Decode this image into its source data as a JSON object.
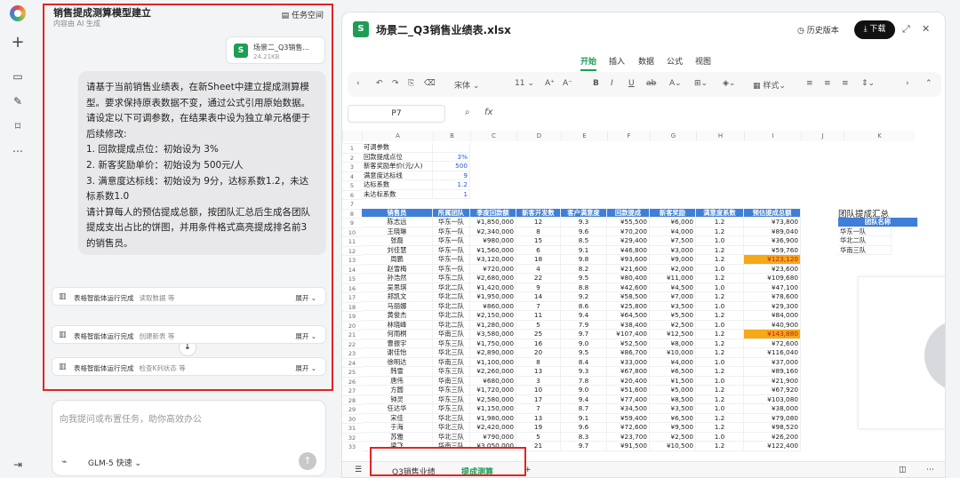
{
  "chat": {
    "title": "销售提成测算模型建立",
    "subtitle": "内容由 AI 生成",
    "task_space": "任务空间",
    "file": {
      "name": "场景二_Q3销售...",
      "size": "24.21KB"
    },
    "prompt_lines": [
      "请基于当前销售业绩表，在新Sheet中建立提成测算模",
      "型。要求保持原表数据不变，通过公式引用原始数据。",
      "请设定以下可调参数，在结果表中设为独立单元格便于",
      "后续修改:",
      "1. 回款提成点位：初始设为 3%",
      "2. 新客奖励单价：初始设为 500元/人",
      "3. 满意度达标线：初始设为 9分，达标系数1.2，未达",
      "标系数1.0",
      "请计算每人的预估提成总额，按团队汇总后生成各团队",
      "提成支出占比的饼图，并用条件格式高亮提成排名前3",
      "的销售员。"
    ],
    "tools": [
      {
        "title": "表格智能体运行完成",
        "detail": "读取数据 等",
        "expand": "展开"
      },
      {
        "title": "表格智能体运行完成",
        "detail": "创建新表 等",
        "expand": "展开"
      },
      {
        "title": "表格智能体运行完成",
        "detail": "检查K列状态 等",
        "expand": "展开"
      }
    ],
    "input_placeholder": "向我提问或布置任务，助你高效办公",
    "model": "GLM-5 快速"
  },
  "sheet": {
    "title": "场景二_Q3销售业绩表.xlsx",
    "history": "历史版本",
    "download": "下载",
    "menus": [
      "开始",
      "插入",
      "数据",
      "公式",
      "视图"
    ],
    "font": "宋体",
    "font_size": "11",
    "style_label": "样式",
    "cell_ref": "P7",
    "columns": [
      "A",
      "B",
      "C",
      "D",
      "E",
      "F",
      "G",
      "H",
      "I",
      "J",
      "K"
    ],
    "params": [
      [
        "可调参数",
        ""
      ],
      [
        "回款提成点位",
        "3%"
      ],
      [
        "新客奖励单价(元/人)",
        "500"
      ],
      [
        "满意度达标线",
        "9"
      ],
      [
        "达标系数",
        "1.2"
      ],
      [
        "未达标系数",
        "1"
      ]
    ],
    "headers": [
      "销售员",
      "所属团队",
      "季度回款额",
      "新客开发数",
      "客户满意度",
      "回款提成",
      "新客奖励",
      "满意度系数",
      "预估提成总额"
    ],
    "rows": [
      [
        "陈志远",
        "华东一队",
        "¥1,850,000",
        "12",
        "9.3",
        "¥55,500",
        "¥6,000",
        "1.2",
        "¥73,800"
      ],
      [
        "王晓琳",
        "华东一队",
        "¥2,340,000",
        "8",
        "9.6",
        "¥70,200",
        "¥4,000",
        "1.2",
        "¥89,040"
      ],
      [
        "张磊",
        "华东一队",
        "¥980,000",
        "15",
        "8.5",
        "¥29,400",
        "¥7,500",
        "1.0",
        "¥36,900"
      ],
      [
        "刘佳慧",
        "华东一队",
        "¥1,560,000",
        "6",
        "9.1",
        "¥46,800",
        "¥3,000",
        "1.2",
        "¥59,760"
      ],
      [
        "周鹏",
        "华东一队",
        "¥3,120,000",
        "18",
        "9.8",
        "¥93,600",
        "¥9,000",
        "1.2",
        "¥123,120"
      ],
      [
        "赵雪梅",
        "华东一队",
        "¥720,000",
        "4",
        "8.2",
        "¥21,600",
        "¥2,000",
        "1.0",
        "¥23,600"
      ],
      [
        "孙浩然",
        "华东二队",
        "¥2,680,000",
        "22",
        "9.5",
        "¥80,400",
        "¥11,000",
        "1.2",
        "¥109,680"
      ],
      [
        "吴思琪",
        "华北二队",
        "¥1,420,000",
        "9",
        "8.8",
        "¥42,600",
        "¥4,500",
        "1.0",
        "¥47,100"
      ],
      [
        "郑凯文",
        "华北二队",
        "¥1,950,000",
        "14",
        "9.2",
        "¥58,500",
        "¥7,000",
        "1.2",
        "¥78,600"
      ],
      [
        "马丽娜",
        "华北二队",
        "¥860,000",
        "7",
        "8.6",
        "¥25,800",
        "¥3,500",
        "1.0",
        "¥29,300"
      ],
      [
        "黄俊杰",
        "华北二队",
        "¥2,150,000",
        "11",
        "9.4",
        "¥64,500",
        "¥5,500",
        "1.2",
        "¥84,000"
      ],
      [
        "林晓峰",
        "华北二队",
        "¥1,280,000",
        "5",
        "7.9",
        "¥38,400",
        "¥2,500",
        "1.0",
        "¥40,900"
      ],
      [
        "何雨桐",
        "华南三队",
        "¥3,580,000",
        "25",
        "9.7",
        "¥107,400",
        "¥12,500",
        "1.2",
        "¥143,880"
      ],
      [
        "曹振宇",
        "华东三队",
        "¥1,750,000",
        "16",
        "9.0",
        "¥52,500",
        "¥8,000",
        "1.2",
        "¥72,600"
      ],
      [
        "谢佳怡",
        "华北三队",
        "¥2,890,000",
        "20",
        "9.5",
        "¥86,700",
        "¥10,000",
        "1.2",
        "¥116,040"
      ],
      [
        "徐明达",
        "华南三队",
        "¥1,100,000",
        "8",
        "8.4",
        "¥33,000",
        "¥4,000",
        "1.0",
        "¥37,000"
      ],
      [
        "韩雪",
        "华东三队",
        "¥2,260,000",
        "13",
        "9.3",
        "¥67,800",
        "¥6,500",
        "1.2",
        "¥89,160"
      ],
      [
        "唐伟",
        "华南三队",
        "¥680,000",
        "3",
        "7.8",
        "¥20,400",
        "¥1,500",
        "1.0",
        "¥21,900"
      ],
      [
        "方圆",
        "华东三队",
        "¥1,720,000",
        "10",
        "9.0",
        "¥51,600",
        "¥5,000",
        "1.2",
        "¥67,920"
      ],
      [
        "钟灵",
        "华东三队",
        "¥2,580,000",
        "17",
        "9.4",
        "¥77,400",
        "¥8,500",
        "1.2",
        "¥103,080"
      ],
      [
        "任达华",
        "华东三队",
        "¥1,150,000",
        "7",
        "8.7",
        "¥34,500",
        "¥3,500",
        "1.0",
        "¥38,000"
      ],
      [
        "宋佳",
        "华北三队",
        "¥1,980,000",
        "13",
        "9.1",
        "¥59,400",
        "¥6,500",
        "1.2",
        "¥79,080"
      ],
      [
        "于海",
        "华北三队",
        "¥2,420,000",
        "19",
        "9.6",
        "¥72,600",
        "¥9,500",
        "1.2",
        "¥98,520"
      ],
      [
        "苏雅",
        "华北三队",
        "¥790,000",
        "5",
        "8.3",
        "¥23,700",
        "¥2,500",
        "1.0",
        "¥26,200"
      ],
      [
        "梁飞",
        "华南三队",
        "¥3,050,000",
        "21",
        "9.7",
        "¥91,500",
        "¥10,500",
        "1.2",
        "¥122,400"
      ]
    ],
    "highlight_rows": [
      4,
      12
    ],
    "summary": {
      "title": "团队提成汇总",
      "header": "团队名称",
      "teams": [
        "华东一队",
        "华北二队",
        "华南三队"
      ]
    },
    "tabs": [
      "Q3销售业绩",
      "提成测算"
    ],
    "active_tab": "提成测算"
  },
  "colors": {
    "accent": "#1f9d55",
    "header_blue": "#3f7fd8",
    "highlight": "#f5a818",
    "red_box": "#e32424"
  }
}
